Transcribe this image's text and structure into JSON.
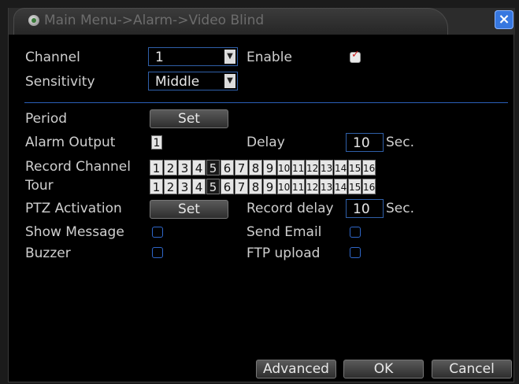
{
  "window": {
    "title": "Main Menu->Alarm->Video Blind",
    "close_label": "×"
  },
  "fields": {
    "channel_label": "Channel",
    "channel_value": "1",
    "enable_label": "Enable",
    "enable_checked": true,
    "sensitivity_label": "Sensitivity",
    "sensitivity_value": "Middle",
    "period_label": "Period",
    "period_button": "Set",
    "alarm_output_label": "Alarm Output",
    "alarm_output_value": "1",
    "delay_label": "Delay",
    "delay_value": "10",
    "delay_unit": "Sec.",
    "record_channel_label": "Record Channel",
    "tour_label": "Tour",
    "ptz_label": "PTZ Activation",
    "ptz_button": "Set",
    "record_delay_label": "Record delay",
    "record_delay_value": "10",
    "record_delay_unit": "Sec.",
    "show_message_label": "Show Message",
    "send_email_label": "Send Email",
    "buzzer_label": "Buzzer",
    "ftp_upload_label": "FTP upload"
  },
  "channels": [
    "1",
    "2",
    "3",
    "4",
    "5",
    "6",
    "7",
    "8",
    "9",
    "10",
    "11",
    "12",
    "13",
    "14",
    "15",
    "16"
  ],
  "footer": {
    "advanced": "Advanced",
    "ok": "OK",
    "cancel": "Cancel"
  },
  "colors": {
    "accent": "#2f5fa8",
    "close": "#3677e0",
    "check": "#d02020"
  },
  "icons": [
    "menu-globe-icon",
    "close-icon",
    "dropdown-arrow-icon",
    "checkmark-icon"
  ]
}
